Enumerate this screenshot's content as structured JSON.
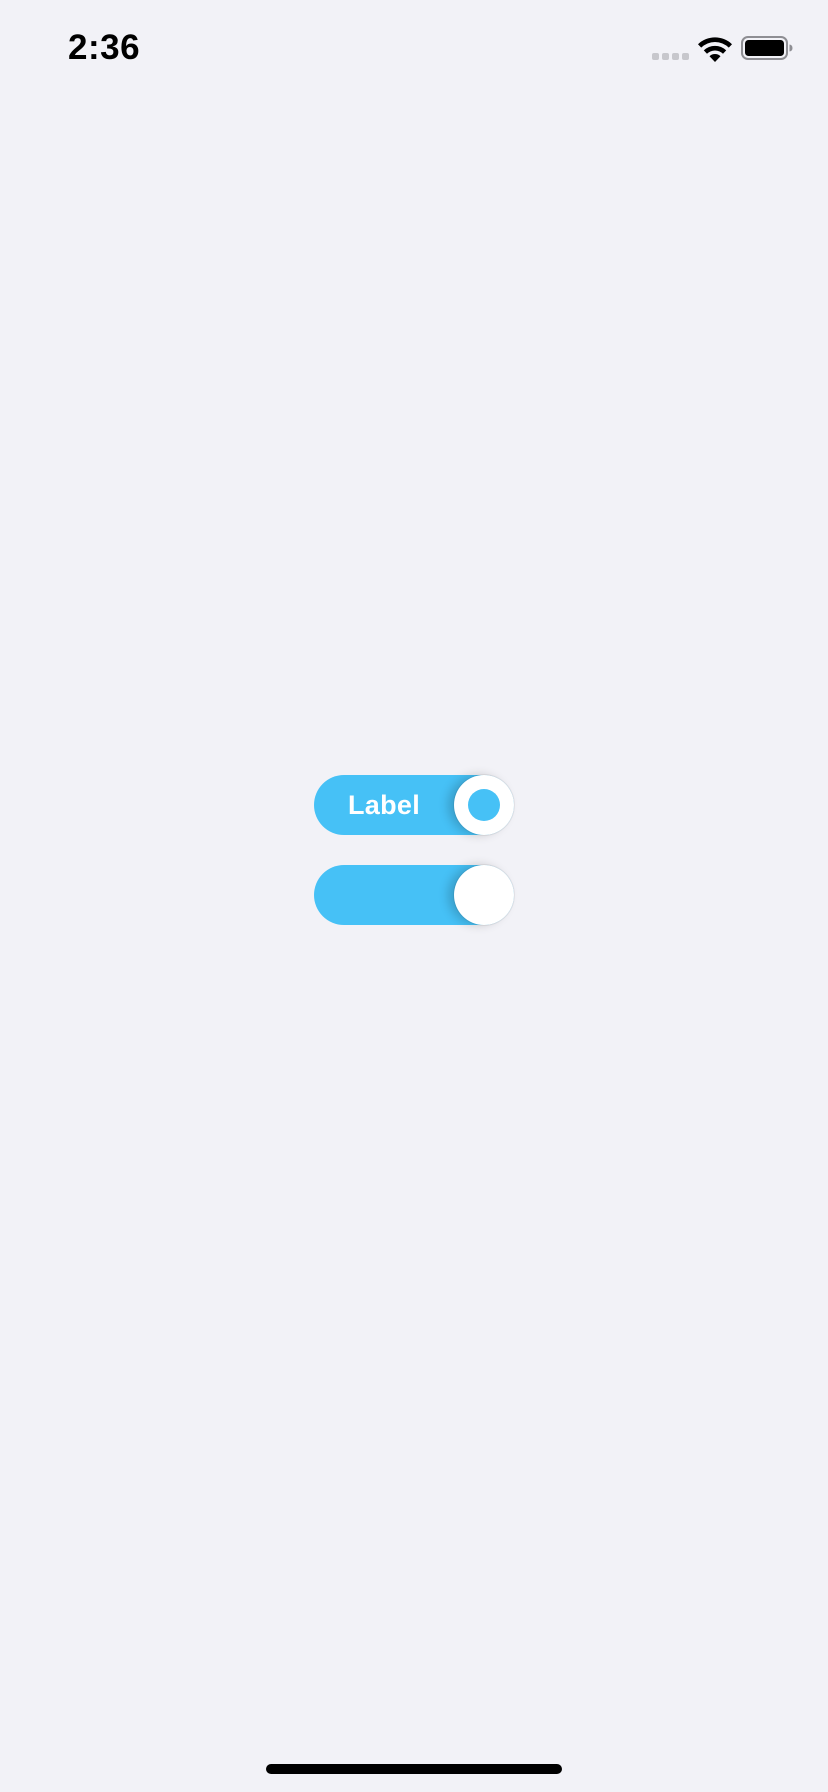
{
  "status_bar": {
    "time": "2:36",
    "signal_icon": "cellular-signal-icon",
    "wifi_icon": "wifi-icon",
    "battery_icon": "battery-icon"
  },
  "toggles": [
    {
      "label": "Label",
      "state": "on"
    },
    {
      "label": "",
      "state": "on"
    }
  ],
  "colors": {
    "background": "#f2f2f7",
    "accent": "#46c1f6",
    "knob": "#ffffff"
  }
}
